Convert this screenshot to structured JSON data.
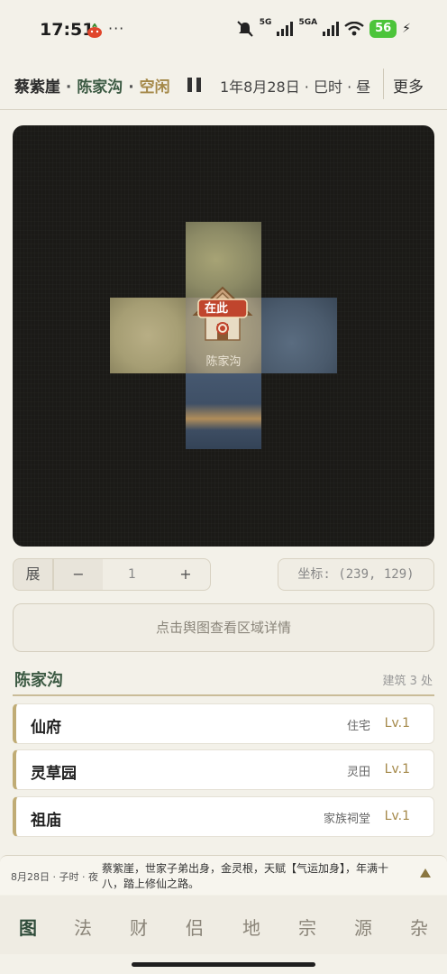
{
  "status_bar": {
    "time": "17:51",
    "dots": "···",
    "signal1_label": "5G",
    "signal2_label": "5GA",
    "battery": "56",
    "icons": [
      "tomato-app-icon",
      "mute-icon",
      "signal-icon",
      "wifi-icon",
      "battery-icon",
      "charging-icon"
    ]
  },
  "header": {
    "character_name": "蔡紫崖",
    "separator": "·",
    "location": "陈家沟",
    "state": "空闲",
    "date": "1年8月28日 · 巳时 · 昼",
    "more_label": "更多",
    "colors": {
      "location": "#3c5a43",
      "state": "#a48848"
    }
  },
  "map": {
    "here_label": "在此",
    "tile_name": "陈家沟"
  },
  "controls": {
    "expand_label": "展",
    "minus_label": "−",
    "step_value": "1",
    "plus_label": "+",
    "coord_text": "坐标: (239, 129)"
  },
  "detail_button": "点击舆图查看区域详情",
  "section": {
    "title": "陈家沟",
    "count": "建筑 3 处"
  },
  "buildings": [
    {
      "name": "仙府",
      "type": "住宅",
      "level": "Lv.1"
    },
    {
      "name": "灵草园",
      "type": "灵田",
      "level": "Lv.1"
    },
    {
      "name": "祖庙",
      "type": "家族祠堂",
      "level": "Lv.1"
    }
  ],
  "log": {
    "time": "8月28日 · 子时 · 夜",
    "text": "蔡紫崖，世家子弟出身，金灵根，天赋【气运加身】，年满十八，踏上修仙之路。"
  },
  "nav": {
    "items": [
      "图",
      "法",
      "财",
      "侣",
      "地",
      "宗",
      "源",
      "杂"
    ],
    "active_index": 0
  }
}
